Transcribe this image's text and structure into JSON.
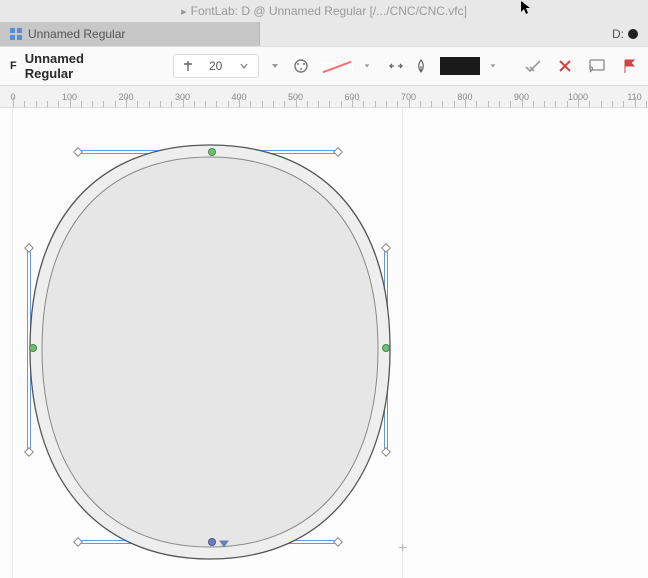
{
  "window": {
    "title": "FontLab: D @ Unnamed Regular [/.../CNC/CNC.vfc]"
  },
  "tabs": {
    "active": {
      "label": "Unnamed Regular"
    },
    "glyph_indicator": {
      "label": "D:"
    }
  },
  "toolbar": {
    "font_name": "Unnamed Regular",
    "size_value": "20"
  },
  "ruler": {
    "labels": [
      "0",
      "100",
      "200",
      "300",
      "400",
      "500",
      "600",
      "700",
      "800",
      "900",
      "1000",
      "110"
    ]
  }
}
